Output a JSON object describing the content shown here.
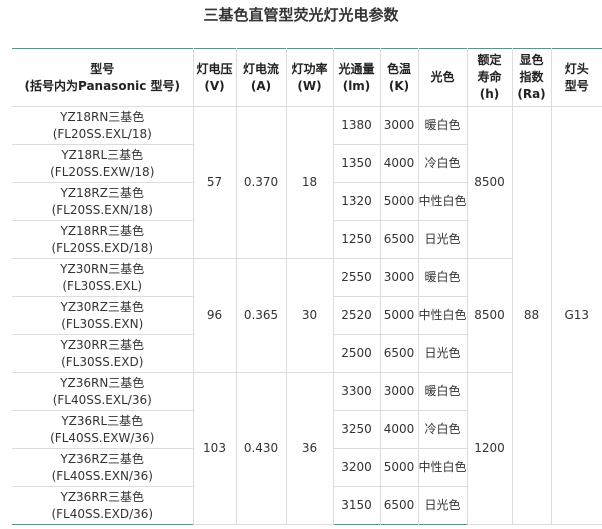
{
  "title": "三基色直管型荧光灯光电参数",
  "headers": [
    {
      "lines": [
        "型号",
        "(括号内为Panasonic 型号)"
      ]
    },
    {
      "lines": [
        "灯电压",
        "(V)"
      ]
    },
    {
      "lines": [
        "灯电流",
        "(A)"
      ]
    },
    {
      "lines": [
        "灯功率",
        "(W)"
      ]
    },
    {
      "lines": [
        "光通量",
        "(lm)"
      ]
    },
    {
      "lines": [
        "色温",
        "(K)"
      ]
    },
    {
      "lines": [
        "光色"
      ]
    },
    {
      "lines": [
        "额定",
        "寿命",
        "(h)"
      ]
    },
    {
      "lines": [
        "显色",
        "指数",
        "(Ra)"
      ]
    },
    {
      "lines": [
        "灯头",
        "型号"
      ]
    }
  ],
  "rows": [
    {
      "model": "YZ18RN三基色",
      "panasonic": "(FL20SS.EXL/18)",
      "flux": "1380",
      "cct": "3000",
      "color": "暖白色"
    },
    {
      "model": "YZ18RL三基色",
      "panasonic": "(FL20SS.EXW/18)",
      "flux": "1350",
      "cct": "4000",
      "color": "冷白色"
    },
    {
      "model": "YZ18RZ三基色",
      "panasonic": "(FL20SS.EXN/18)",
      "flux": "1320",
      "cct": "5000",
      "color": "中性白色"
    },
    {
      "model": "YZ18RR三基色",
      "panasonic": "(FL20SS.EXD/18)",
      "flux": "1250",
      "cct": "6500",
      "color": "日光色"
    },
    {
      "model": "YZ30RN三基色",
      "panasonic": "(FL30SS.EXL)",
      "flux": "2550",
      "cct": "3000",
      "color": "暖白色"
    },
    {
      "model": "YZ30RZ三基色",
      "panasonic": "(FL30SS.EXN)",
      "flux": "2520",
      "cct": "5000",
      "color": "中性白色"
    },
    {
      "model": "YZ30RR三基色",
      "panasonic": "(FL30SS.EXD)",
      "flux": "2500",
      "cct": "6500",
      "color": "日光色"
    },
    {
      "model": "YZ36RN三基色",
      "panasonic": "(FL40SS.EXL/36)",
      "flux": "3300",
      "cct": "3000",
      "color": "暖白色"
    },
    {
      "model": "YZ36RL三基色",
      "panasonic": "(FL40SS.EXW/36)",
      "flux": "3250",
      "cct": "4000",
      "color": "冷白色"
    },
    {
      "model": "YZ36RZ三基色",
      "panasonic": "(FL40SS.EXN/36)",
      "flux": "3200",
      "cct": "5000",
      "color": "中性白色"
    },
    {
      "model": "YZ36RR三基色",
      "panasonic": "(FL40SS.EXD/36)",
      "flux": "3150",
      "cct": "6500",
      "color": "日光色"
    }
  ],
  "groups": [
    {
      "voltage": "57",
      "current": "0.370",
      "power": "18"
    },
    {
      "voltage": "96",
      "current": "0.365",
      "power": "30"
    },
    {
      "voltage": "103",
      "current": "0.430",
      "power": "36"
    }
  ],
  "life": [
    "8500",
    "8500",
    "1200"
  ],
  "ra": "88",
  "cap": "G13"
}
